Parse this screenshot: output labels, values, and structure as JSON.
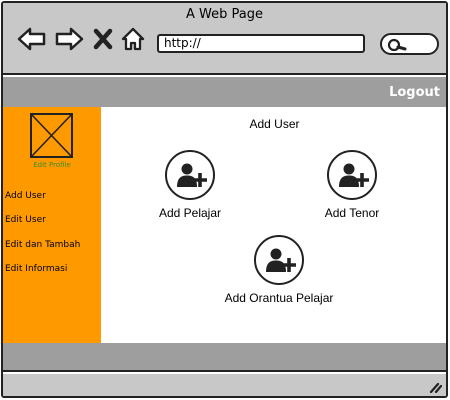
{
  "browser": {
    "title": "A Web Page",
    "url": "http://",
    "icons": [
      "back-arrow-icon",
      "forward-arrow-icon",
      "close-x-icon",
      "home-icon",
      "search-icon"
    ]
  },
  "header": {
    "logout_label": "Logout"
  },
  "sidebar": {
    "edit_profile_label": "Edit Profile",
    "items": [
      {
        "label": "Add User"
      },
      {
        "label": "Edit User"
      },
      {
        "label": "Edit dan Tambah"
      },
      {
        "label": "Edit Informasi"
      }
    ]
  },
  "main": {
    "title": "Add User",
    "actions": [
      {
        "label": "Add Pelajar",
        "icon": "add-user-icon"
      },
      {
        "label": "Add Tenor",
        "icon": "add-user-icon"
      },
      {
        "label": "Add Orantua Pelajar",
        "icon": "add-user-icon"
      }
    ]
  },
  "colors": {
    "sidebar": "#ff9900",
    "bars": "#9e9e9e",
    "chrome": "#c8c8c8",
    "edit_profile_text": "#3a8f2a"
  }
}
